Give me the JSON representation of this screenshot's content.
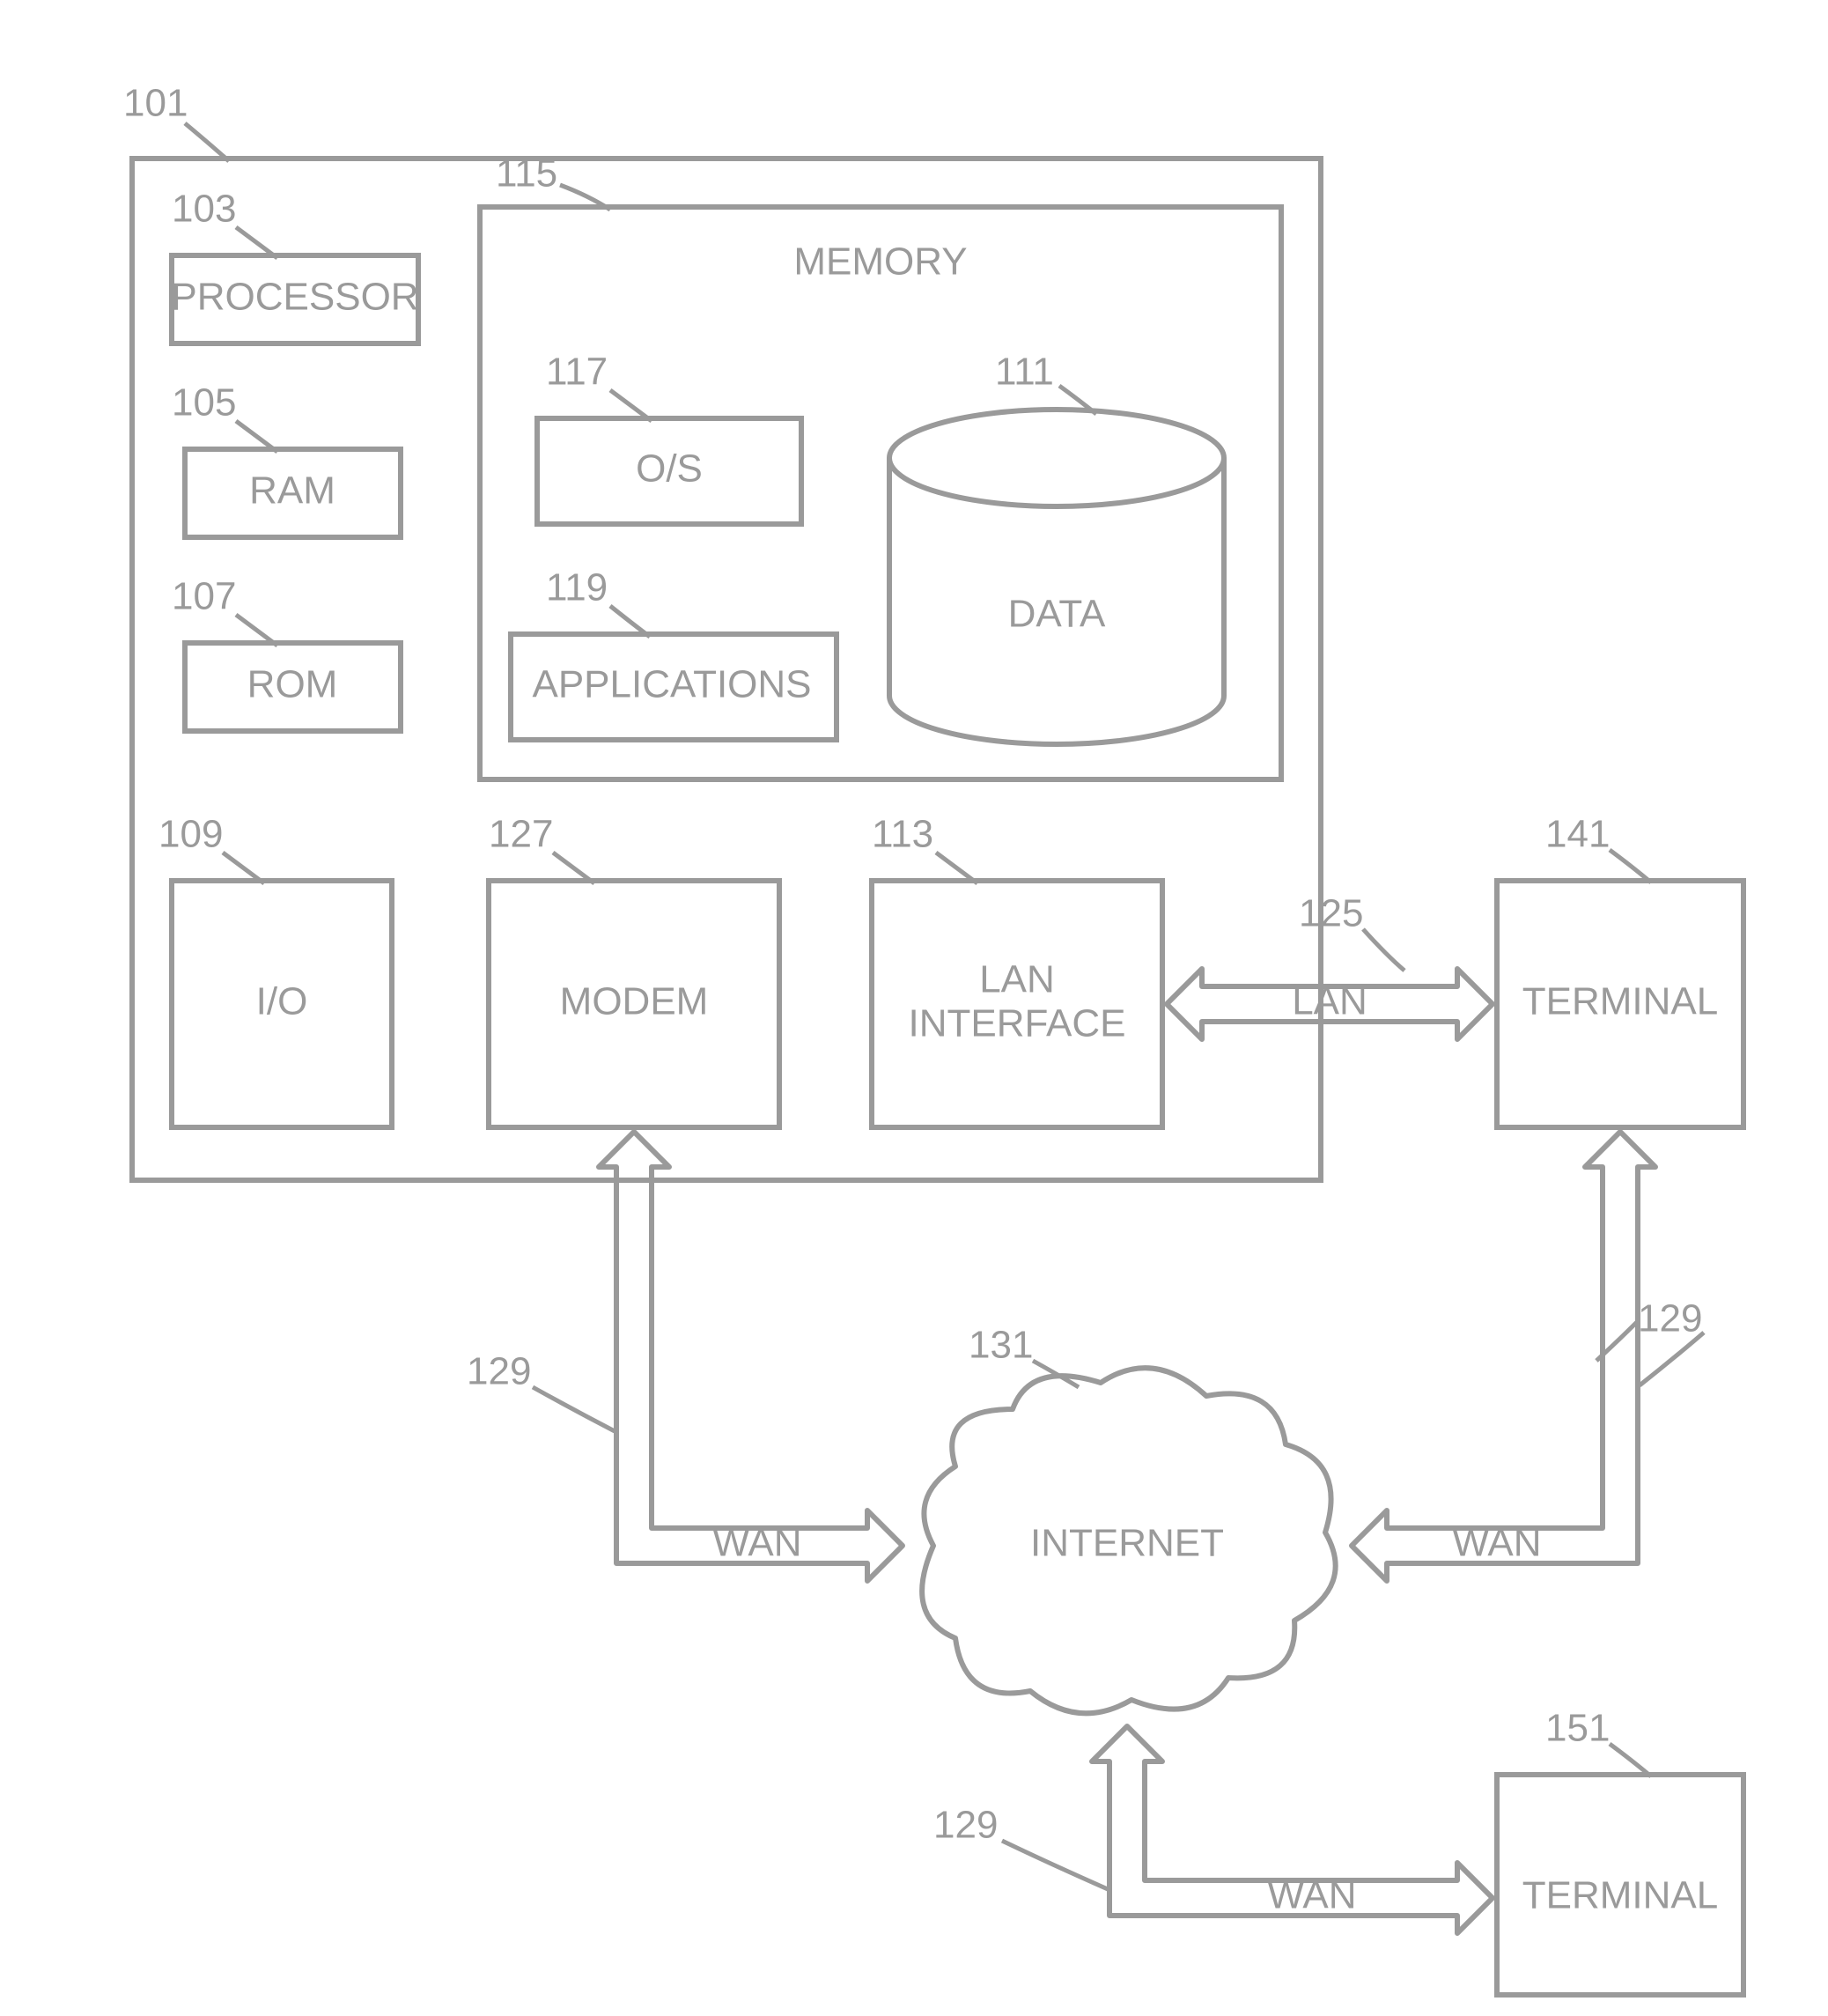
{
  "refs": {
    "main": "101",
    "processor": "103",
    "ram": "105",
    "rom": "107",
    "io": "109",
    "memory": "115",
    "os": "117",
    "apps": "119",
    "data": "111",
    "modem": "127",
    "lan_if": "113",
    "lan": "125",
    "terminal1": "141",
    "wan_left": "129",
    "wan_right": "129",
    "wan_bottom": "129",
    "internet": "131",
    "terminal2": "151"
  },
  "labels": {
    "processor": "PROCESSOR",
    "ram": "RAM",
    "rom": "ROM",
    "io": "I/O",
    "memory": "MEMORY",
    "os": "O/S",
    "apps": "APPLICATIONS",
    "data": "DATA",
    "modem": "MODEM",
    "lan_if": "LAN\nINTERFACE",
    "lan": "LAN",
    "terminal": "TERMINAL",
    "wan": "WAN",
    "internet": "INTERNET"
  }
}
